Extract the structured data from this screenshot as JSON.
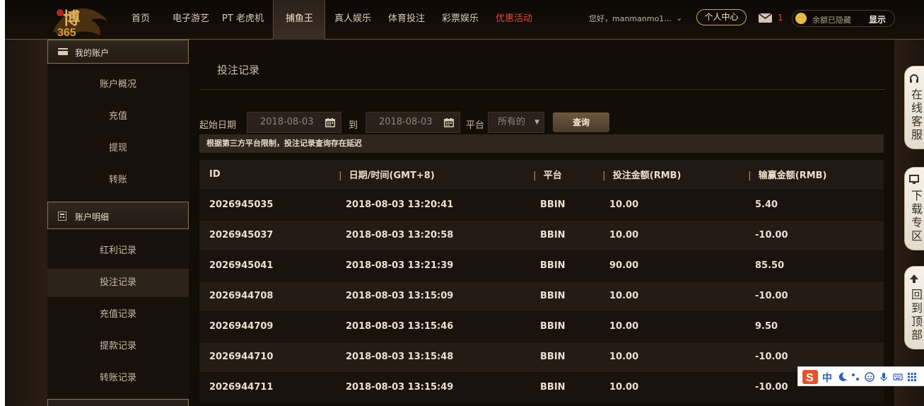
{
  "header": {
    "logo_text": "博365",
    "nav": [
      "首页",
      "电子游艺",
      "PT 老虎机",
      "捕鱼王",
      "真人娱乐",
      "体育投注",
      "彩票娱乐",
      "优惠活动"
    ],
    "active_nav": "捕鱼王",
    "greeting": "您好，manmanmo1...",
    "personal_center": "个人中心",
    "mail_count": "1",
    "balance_hidden": "余额已隐藏",
    "show_label": "显示"
  },
  "sidebar": {
    "account_head": "我的账户",
    "account_items": [
      "账户概况",
      "充值",
      "提现",
      "转账"
    ],
    "detail_head": "账户明细",
    "detail_items": [
      "红利记录",
      "投注记录",
      "充值记录",
      "提款记录",
      "转账记录"
    ],
    "active_item": "投注记录"
  },
  "content": {
    "title": "投注记录",
    "filter": {
      "start_label": "起始日期",
      "start_value": "2018-08-03",
      "to_label": "到",
      "end_value": "2018-08-03",
      "platform_label": "平台",
      "platform_value": "所有的",
      "query_button": "查询"
    },
    "notice": "根据第三方平台限制，投注记录查询存在延迟",
    "table": {
      "headers": [
        "ID",
        "日期/时间(GMT+8)",
        "平台",
        "投注金额(RMB)",
        "输赢金额(RMB)"
      ],
      "rows": [
        [
          "2026945035",
          "2018-08-03 13:20:41",
          "BBIN",
          "10.00",
          "5.40"
        ],
        [
          "2026945037",
          "2018-08-03 13:20:58",
          "BBIN",
          "10.00",
          "-10.00"
        ],
        [
          "2026945041",
          "2018-08-03 13:21:39",
          "BBIN",
          "90.00",
          "85.50"
        ],
        [
          "2026944708",
          "2018-08-03 13:15:09",
          "BBIN",
          "10.00",
          "-10.00"
        ],
        [
          "2026944709",
          "2018-08-03 13:15:46",
          "BBIN",
          "10.00",
          "9.50"
        ],
        [
          "2026944710",
          "2018-08-03 13:15:48",
          "BBIN",
          "10.00",
          "-10.00"
        ],
        [
          "2026944711",
          "2018-08-03 13:15:49",
          "BBIN",
          "10.00",
          "-10.00"
        ]
      ]
    }
  },
  "right_rail": [
    {
      "text": "在线客服"
    },
    {
      "text": "下载专区"
    },
    {
      "text": "回到顶部"
    }
  ],
  "ime": {
    "lang": "中"
  },
  "colors": {
    "accent_gold": "#c9a86a",
    "promo_red": "#e8463a",
    "background": "#130d08"
  }
}
